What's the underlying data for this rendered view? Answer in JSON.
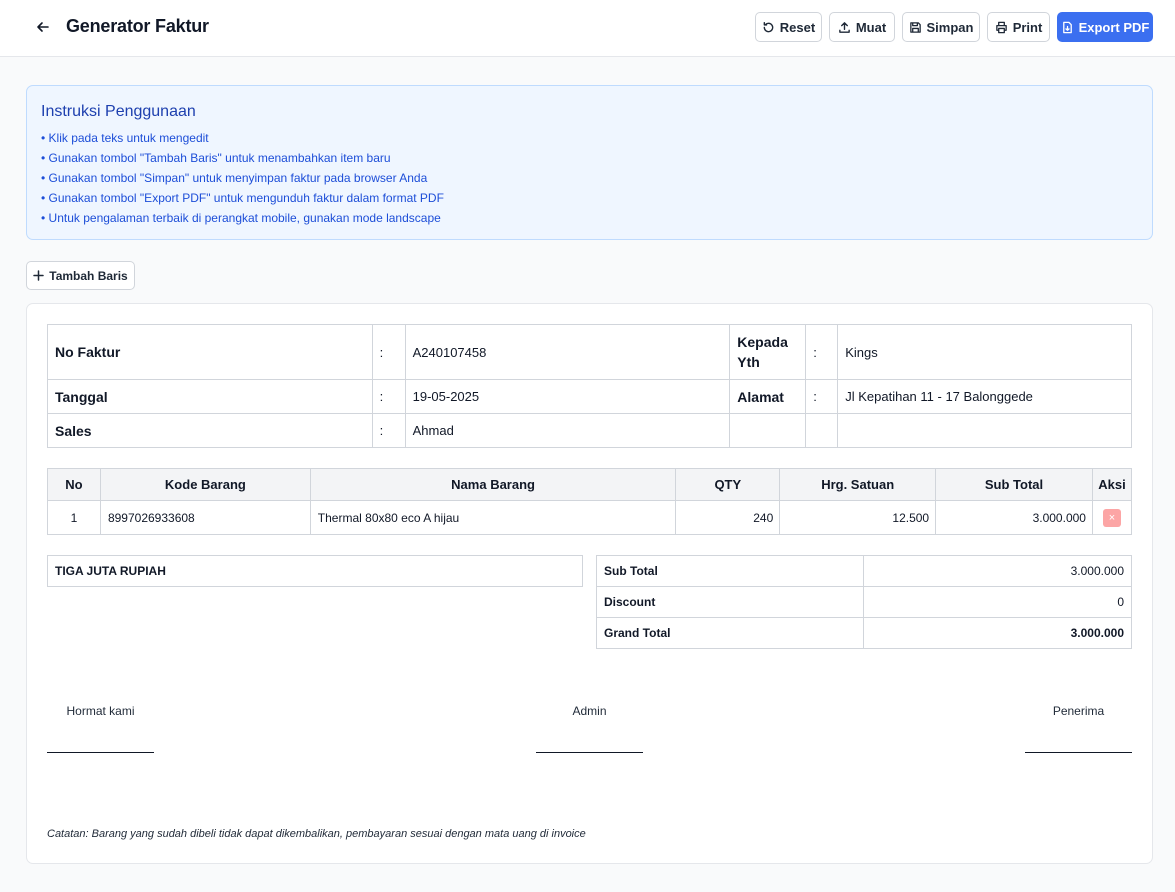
{
  "header": {
    "title": "Generator Faktur",
    "buttons": {
      "reset": "Reset",
      "load": "Muat",
      "save": "Simpan",
      "print": "Print",
      "export": "Export PDF"
    }
  },
  "instructions": {
    "title": "Instruksi Penggunaan",
    "items": [
      "• Klik pada teks untuk mengedit",
      "• Gunakan tombol \"Tambah Baris\" untuk menambahkan item baru",
      "• Gunakan tombol \"Simpan\" untuk menyimpan faktur pada browser Anda",
      "• Gunakan tombol \"Export PDF\" untuk mengunduh faktur dalam format PDF",
      "• Untuk pengalaman terbaik di perangkat mobile, gunakan mode landscape"
    ]
  },
  "add_row_label": "Tambah Baris",
  "invoice": {
    "sep": ":",
    "no_label": "No Faktur",
    "no_value": "A240107458",
    "to_label": "Kepada Yth",
    "to_value": "Kings",
    "date_label": "Tanggal",
    "date_value": "19-05-2025",
    "address_label": "Alamat",
    "address_value": "Jl Kepatihan 11 - 17 Balonggede",
    "sales_label": "Sales",
    "sales_value": "Ahmad"
  },
  "items_table": {
    "columns": [
      "No",
      "Kode Barang",
      "Nama Barang",
      "QTY",
      "Hrg. Satuan",
      "Sub Total",
      "Aksi"
    ],
    "rows": [
      {
        "no": "1",
        "code": "8997026933608",
        "name": "Thermal 80x80 eco A hijau",
        "qty": "240",
        "price": "12.500",
        "subtotal": "3.000.000",
        "delete": "×"
      }
    ]
  },
  "amount_words": "TIGA JUTA RUPIAH",
  "totals": {
    "subtotal_label": "Sub Total",
    "subtotal_value": "3.000.000",
    "discount_label": "Discount",
    "discount_value": "0",
    "grand_label": "Grand Total",
    "grand_value": "3.000.000"
  },
  "signatures": {
    "left": "Hormat kami",
    "center": "Admin",
    "right": "Penerima"
  },
  "note": "Catatan: Barang yang sudah dibeli tidak dapat dikembalikan, pembayaran sesuai dengan mata uang di invoice",
  "colors": {
    "primary": "#3b6ff0",
    "info_bg": "#eff6ff",
    "info_text": "#1d4ed8",
    "delete": "#fca5a5"
  }
}
